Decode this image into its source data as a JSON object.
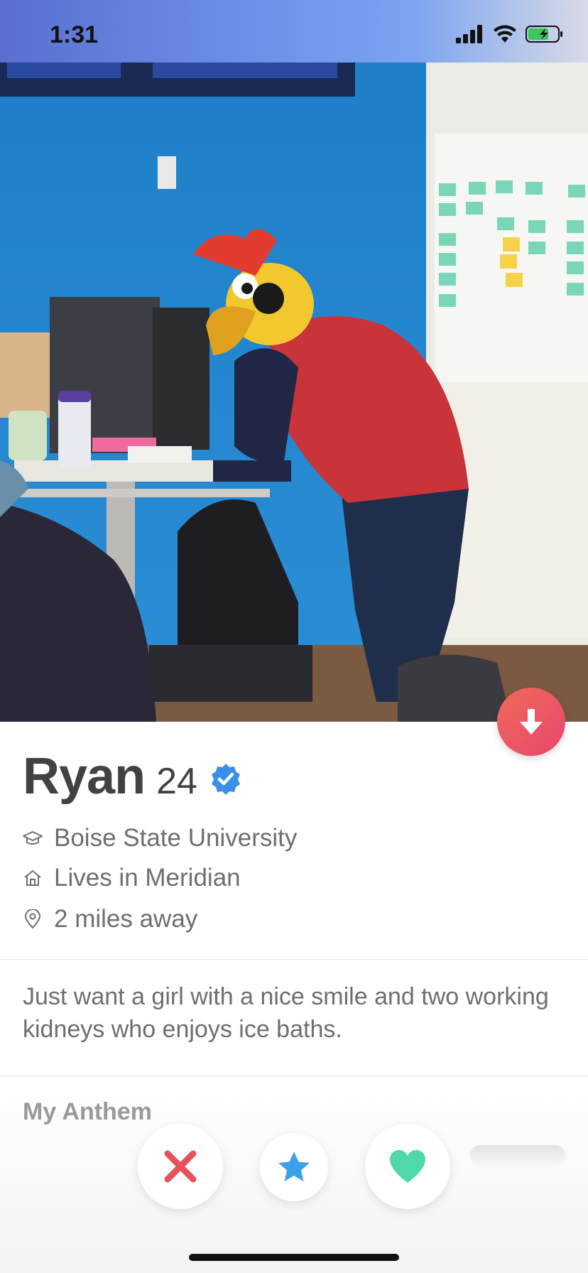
{
  "status_bar": {
    "time": "1:31"
  },
  "profile": {
    "name": "Ryan",
    "age": "24",
    "school": "Boise State University",
    "lives_in": "Lives in Meridian",
    "distance": "2 miles away",
    "bio": "Just want a girl with a nice smile and two working kidneys who enjoys ice baths."
  },
  "sections": {
    "anthem_title": "My Anthem"
  },
  "icons": {
    "verified": "verified-badge-icon",
    "school": "graduation-cap-icon",
    "home": "home-icon",
    "location": "location-pin-icon",
    "collapse": "arrow-down-icon",
    "nope": "x-icon",
    "super_like": "star-icon",
    "like": "heart-icon"
  },
  "colors": {
    "nope": "#e8505b",
    "super_like": "#3aa0e8",
    "like": "#4fd8a8",
    "verified": "#3b8fe8",
    "collapse_start": "#f06a5a",
    "collapse_end": "#e8456e"
  }
}
